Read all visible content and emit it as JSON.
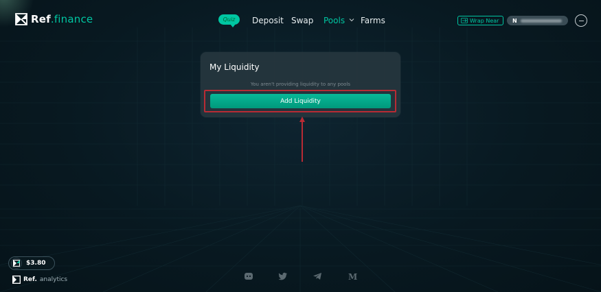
{
  "header": {
    "logo_text_main": "Ref",
    "logo_text_accent": ".finance",
    "quiz_badge": "Quiz",
    "nav": [
      {
        "label": "Deposit",
        "active": false
      },
      {
        "label": "Swap",
        "active": false
      },
      {
        "label": "Pools",
        "active": true
      },
      {
        "label": "Farms",
        "active": false
      }
    ],
    "wrap_near_label": "Wrap Near",
    "account_initial": "N",
    "more_icon": "minus-circle-icon"
  },
  "card": {
    "title": "My Liquidity",
    "message": "You aren't providing liquidity to any pools",
    "add_button_label": "Add Liquidity"
  },
  "footer": {
    "token_price": "$3.80",
    "analytics_main": "Ref.",
    "analytics_accent": "analytics",
    "social_icons": [
      "discord-icon",
      "twitter-icon",
      "telegram-icon",
      "medium-icon"
    ]
  },
  "colors": {
    "accent": "#00c6a2",
    "background": "#081921",
    "card": "#26363e",
    "highlight": "#b92b34"
  }
}
